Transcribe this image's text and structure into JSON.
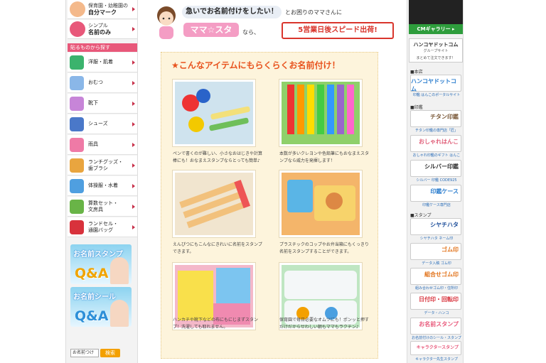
{
  "sidebar": {
    "top_items": [
      {
        "line1": "保育園・幼稚園の",
        "line2": "自分マーク",
        "icon": "kids-face-icon"
      },
      {
        "line1": "シンプル",
        "line2": "名前のみ",
        "icon": "shizuku-badge-icon"
      }
    ],
    "category_header": "貼るものから探す",
    "categories": [
      {
        "label": "洋服・肌着",
        "icon": "shirt-icon",
        "color": "#3bb36d"
      },
      {
        "label": "おむつ",
        "icon": "diaper-icon",
        "color": "#8ab7e8"
      },
      {
        "label": "靴下",
        "icon": "sock-icon",
        "color": "#c785d8"
      },
      {
        "label": "シューズ",
        "icon": "shoe-icon",
        "color": "#4a78c9"
      },
      {
        "label": "雨具",
        "icon": "umbrella-icon",
        "color": "#ef7aa6"
      },
      {
        "label": "ランチグッズ・\n歯ブラシ",
        "icon": "lunch-icon",
        "color": "#e9a53f"
      },
      {
        "label": "体操服・水着",
        "icon": "swimsuit-icon",
        "color": "#4f9fe0"
      },
      {
        "label": "算数セット・\n文房具",
        "icon": "math-set-icon",
        "color": "#69b447"
      },
      {
        "label": "ランドセル・\n通園バッグ",
        "icon": "backpack-icon",
        "color": "#d8323c"
      }
    ],
    "banners": [
      {
        "title": "お名前スタンプ",
        "qa": "Q&A"
      },
      {
        "title": "お名前シール",
        "qa": "Q&A"
      }
    ],
    "search_select": "お名前つけ",
    "search_button": "検索"
  },
  "header": {
    "headline": "急いでお名前付けをしたい！",
    "headline_suffix": "とお困りのママさんに",
    "mama_title": "ママ☆スタ",
    "nara": "なら、",
    "speed": "5営業日後スピード出荷!"
  },
  "content": {
    "title": "★こんなアイテムにもらくらくお名前付け！",
    "items": [
      {
        "caption": "ペンで書くのが難しい、小さなおはじきや計算棒にも！おなまえスタンプならとっても簡単♪",
        "photo_color": "#cfe3ee"
      },
      {
        "caption": "本数が多いクレヨンや色鉛筆にもおなまえスタンプなら威力を発揮します！",
        "photo_color": "#8fd06a"
      },
      {
        "caption": "えんぴつにもこんなにきれいに名前をスタンプできます。",
        "photo_color": "#f1e5cf"
      },
      {
        "caption": "プラスチックのコップやお弁当箱にもくっきり名前をスタンプすることができます。",
        "photo_color": "#f4b56a"
      },
      {
        "caption": "ハンカチや靴下などの布にもにじまずスタンプ！洗濯しても取れません。",
        "photo_color": "#f4b8c9"
      },
      {
        "caption": "保育園で毎日必要なオムツにも！ポンッと押すだけだからせわしい朝もママもラクチン♪",
        "photo_color": "#bfe6c2"
      }
    ]
  },
  "right_sidebar": {
    "cm_button": "CMギャラリー ▸",
    "group_title": "ハンコヤドットコム",
    "group_subtitle": "グループサイト",
    "group_note": "まとめて注文できます！",
    "sections": [
      {
        "label": "■本店",
        "items": [
          {
            "title": "ハンコヤドットコム",
            "caption": "印鑑 はんこのポータルサイト",
            "color": "#2e7fcf"
          }
        ]
      },
      {
        "label": "■印鑑",
        "items": [
          {
            "title": "チタン印鑑",
            "caption": "チタン印鑑の専門店「匠」",
            "color": "#7b5a3a"
          },
          {
            "title": "おしゃれはんこ",
            "caption": "おしゃれ印鑑のギフト はんこ",
            "color": "#e0607a"
          },
          {
            "title": "シルバー印鑑",
            "caption": "シルバー 印鑑 CODE925",
            "color": "#333333"
          },
          {
            "title": "印鑑ケース",
            "caption": "印鑑ケース専門店",
            "color": "#2e7fcf"
          }
        ]
      },
      {
        "label": "■スタンプ",
        "items": [
          {
            "title": "シヤチハタ",
            "caption": "シヤチハタ ネーム印",
            "color": "#1d4e9a"
          },
          {
            "title": "ゴム印",
            "caption": "データ入稿 ゴム印",
            "color": "#e2741c"
          },
          {
            "title": "組合せゴム印",
            "caption": "組み合わせゴム印・住所印",
            "color": "#e2741c"
          },
          {
            "title": "日付印・回転印",
            "caption": "データ・ハンコ",
            "color": "#d8323c"
          },
          {
            "title": "お名前スタンプ",
            "caption": "お名前付けのシール・スタンプ",
            "color": "#e8587a"
          },
          {
            "title": "キャラクタースタンプ",
            "caption": "キャラクター先生スタンプ",
            "color": "#e8587a"
          }
        ]
      }
    ]
  }
}
